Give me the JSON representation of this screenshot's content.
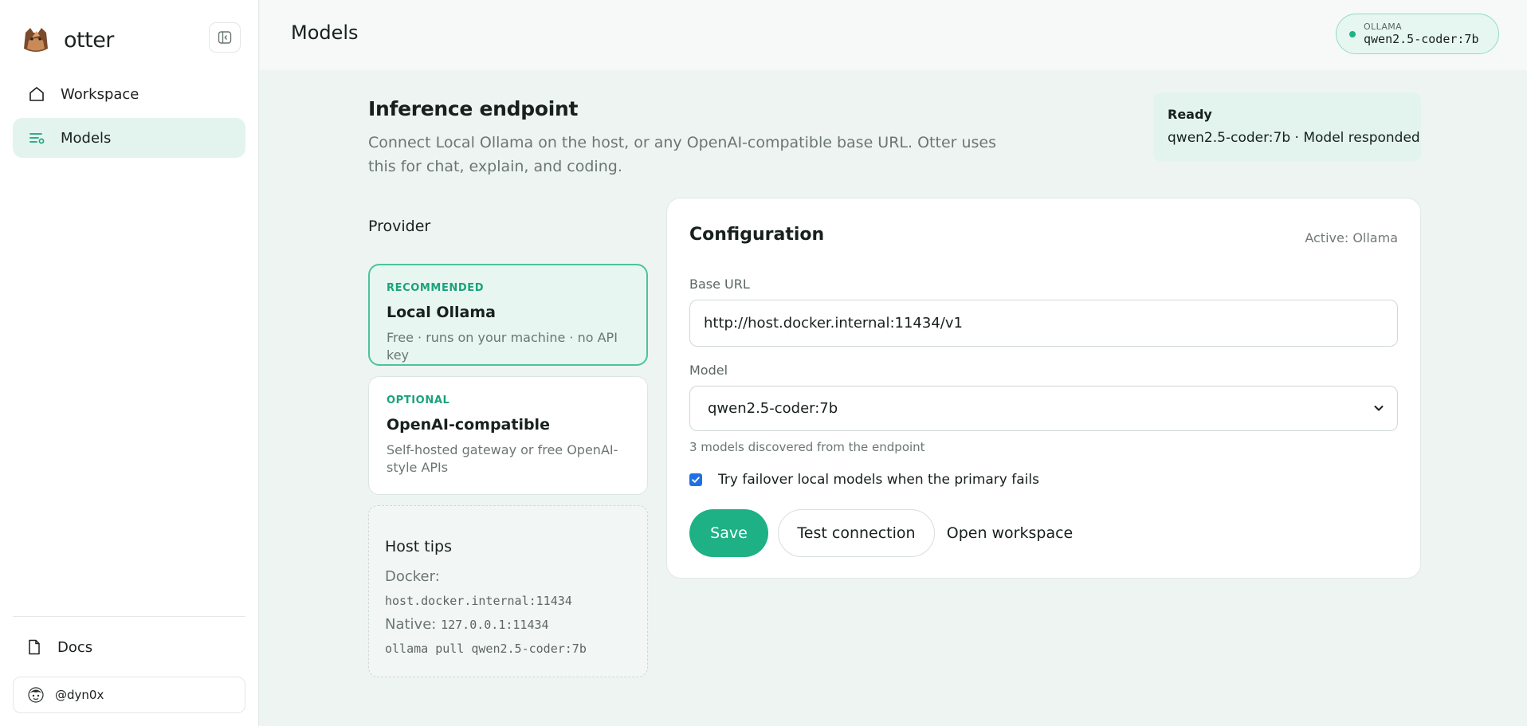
{
  "app": {
    "name": "otter"
  },
  "sidebar": {
    "items": [
      {
        "label": "Workspace",
        "icon": "home-icon",
        "active": false
      },
      {
        "label": "Models",
        "icon": "models-list-icon",
        "active": true
      }
    ],
    "docs_label": "Docs",
    "user": {
      "handle": "@dyn0x"
    }
  },
  "header": {
    "title": "Models",
    "status_pill": {
      "provider": "OLLAMA",
      "model": "qwen2.5-coder:7b",
      "dot_color": "#1fb286"
    }
  },
  "endpoint": {
    "title": "Inference endpoint",
    "description": "Connect Local Ollama on the host, or any OpenAI-compatible base URL. Otter uses this for chat, explain, and coding.",
    "status": {
      "title": "Ready",
      "detail": "qwen2.5-coder:7b · Model responded"
    }
  },
  "provider": {
    "heading": "Provider",
    "options": [
      {
        "tag": "RECOMMENDED",
        "name": "Local Ollama",
        "subtitle": "Free · runs on your machine · no API key",
        "selected": true
      },
      {
        "tag": "OPTIONAL",
        "name": "OpenAI-compatible",
        "subtitle": "Self-hosted gateway or free OpenAI-style APIs",
        "selected": false
      }
    ],
    "tips": {
      "title": "Host tips",
      "docker_label": "Docker:",
      "docker_host": "host.docker.internal:11434",
      "native_label": "Native:",
      "native_host": "127.0.0.1:11434",
      "pull_command": "ollama pull qwen2.5-coder:7b"
    }
  },
  "config": {
    "title": "Configuration",
    "active_label": "Active: Ollama",
    "base_url_label": "Base URL",
    "base_url_value": "http://host.docker.internal:11434/v1",
    "model_label": "Model",
    "model_value": "qwen2.5-coder:7b",
    "discovered_text": "3 models discovered from the endpoint",
    "failover_label": "Try failover local models when the primary fails",
    "failover_checked": true,
    "buttons": {
      "save": "Save",
      "test": "Test connection",
      "open": "Open workspace"
    }
  },
  "colors": {
    "accent": "#1db185",
    "accent_light": "#e3f4ee",
    "checkbox": "#1f6fe5"
  }
}
